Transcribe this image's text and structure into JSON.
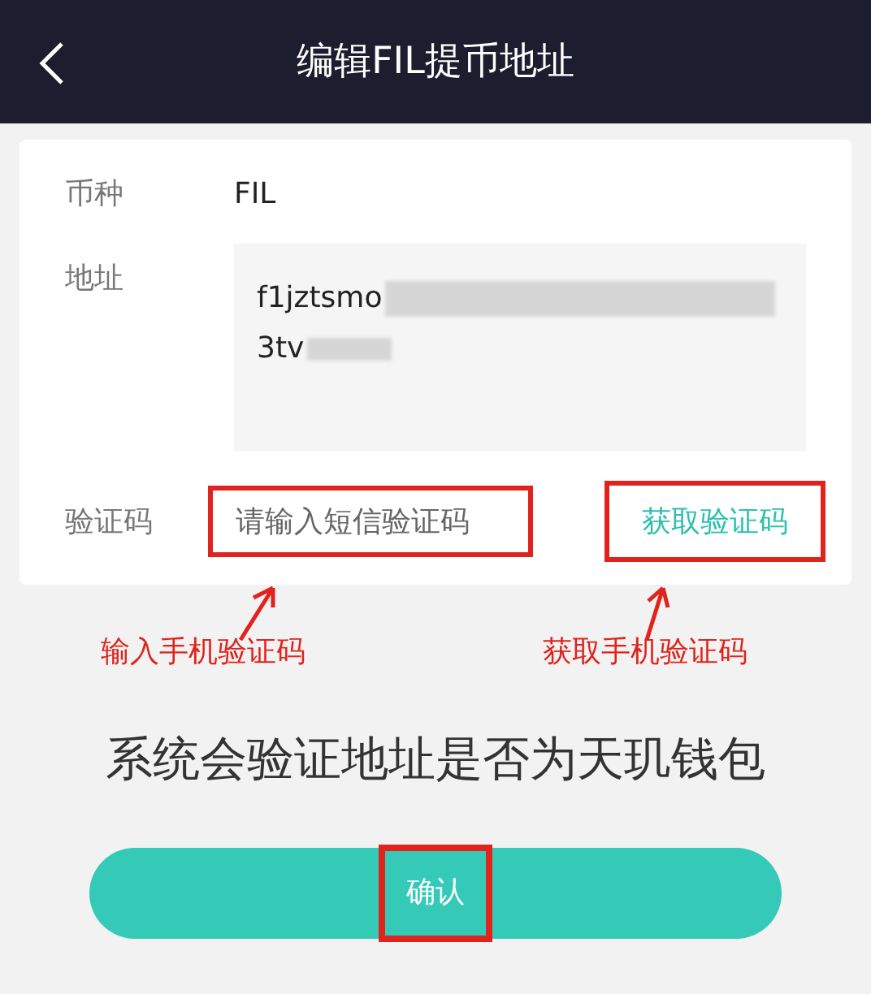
{
  "header": {
    "title": "编辑FIL提币地址"
  },
  "form": {
    "coin": {
      "label": "币种",
      "value": "FIL"
    },
    "address": {
      "label": "地址",
      "lines": [
        "f1jztsmo",
        "3tv"
      ]
    },
    "code": {
      "label": "验证码",
      "placeholder": "请输入短信验证码",
      "button": "获取验证码"
    }
  },
  "annotations": [
    "输入手机验证码",
    "获取手机验证码"
  ],
  "notice": "系统会验证地址是否为天玑钱包",
  "confirm_button": "确认"
}
